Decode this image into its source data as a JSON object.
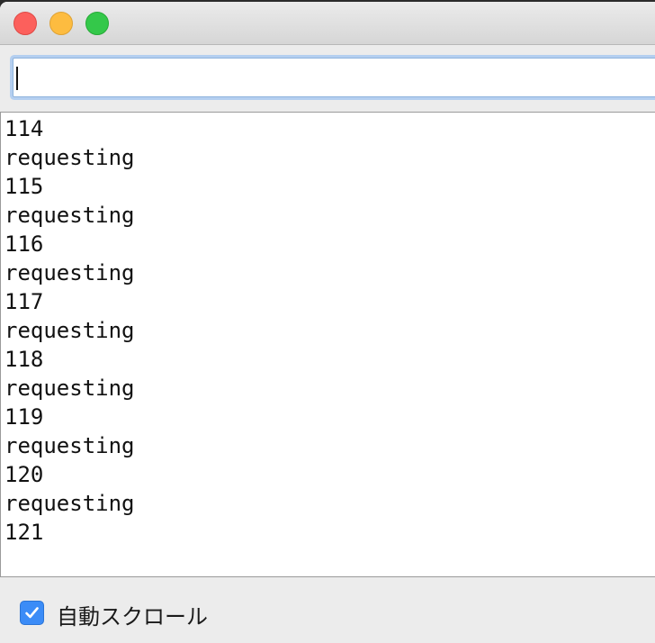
{
  "window": {
    "title_fragment": "/"
  },
  "input": {
    "value": ""
  },
  "output": {
    "lines": [
      "114",
      "requesting",
      "115",
      "requesting",
      "116",
      "requesting",
      "117",
      "requesting",
      "118",
      "requesting",
      "119",
      "requesting",
      "120",
      "requesting",
      "121"
    ]
  },
  "footer": {
    "autoscroll_label": "自動スクロール",
    "autoscroll_checked": true
  },
  "colors": {
    "accent": "#3b8cf7",
    "close": "#fc605c",
    "minimize": "#fdbc40",
    "zoom": "#34c84a"
  },
  "icons": [
    "close-icon",
    "minimize-icon",
    "zoom-icon",
    "checkmark-icon"
  ]
}
